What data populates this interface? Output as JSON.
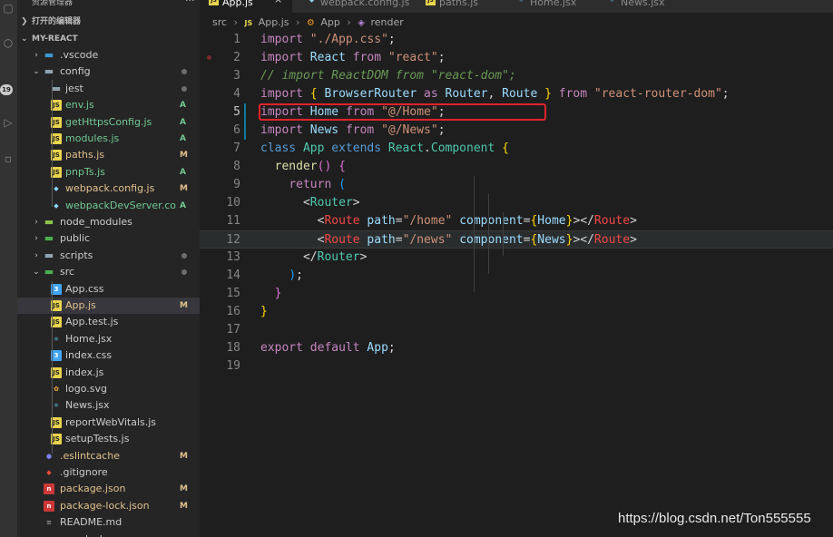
{
  "sidebar": {
    "title": "资源管理器",
    "open_editors": "打开的编辑器",
    "project": "MY-REACT",
    "items": [
      {
        "name": ".vscode",
        "kind": "folder",
        "icon": "vscode-folder-icon",
        "status": "",
        "dot": false
      },
      {
        "name": "config",
        "kind": "folder-open",
        "icon": "folder-icon",
        "status": "",
        "dot": true
      },
      {
        "name": "jest",
        "kind": "folder",
        "icon": "folder-icon",
        "status": "",
        "dot": true
      },
      {
        "name": "env.js",
        "kind": "file",
        "icon": "js-icon",
        "status": "A"
      },
      {
        "name": "getHttpsConfig.js",
        "kind": "file",
        "icon": "js-icon",
        "status": "A"
      },
      {
        "name": "modules.js",
        "kind": "file",
        "icon": "js-icon",
        "status": "A"
      },
      {
        "name": "paths.js",
        "kind": "file",
        "icon": "js-icon",
        "status": "M"
      },
      {
        "name": "pnpTs.js",
        "kind": "file",
        "icon": "js-icon",
        "status": "A"
      },
      {
        "name": "webpack.config.js",
        "kind": "file",
        "icon": "webpack-icon",
        "status": "M"
      },
      {
        "name": "webpackDevServer.co...",
        "kind": "file",
        "icon": "webpack-icon",
        "status": "A"
      },
      {
        "name": "node_modules",
        "kind": "folder",
        "icon": "node-folder-icon",
        "status": ""
      },
      {
        "name": "public",
        "kind": "folder",
        "icon": "public-folder-icon",
        "status": ""
      },
      {
        "name": "scripts",
        "kind": "folder",
        "icon": "folder-icon",
        "status": "",
        "dot": true
      },
      {
        "name": "src",
        "kind": "folder-open",
        "icon": "src-folder-icon",
        "status": "",
        "dot": true
      },
      {
        "name": "App.css",
        "kind": "file",
        "icon": "css-icon",
        "status": ""
      },
      {
        "name": "App.js",
        "kind": "file",
        "icon": "js-icon",
        "status": "M",
        "selected": true
      },
      {
        "name": "App.test.js",
        "kind": "file",
        "icon": "js-icon",
        "status": ""
      },
      {
        "name": "Home.jsx",
        "kind": "file",
        "icon": "react-icon",
        "status": ""
      },
      {
        "name": "index.css",
        "kind": "file",
        "icon": "css-icon",
        "status": ""
      },
      {
        "name": "index.js",
        "kind": "file",
        "icon": "js-icon",
        "status": ""
      },
      {
        "name": "logo.svg",
        "kind": "file",
        "icon": "svg-icon",
        "status": ""
      },
      {
        "name": "News.jsx",
        "kind": "file",
        "icon": "react-icon",
        "status": ""
      },
      {
        "name": "reportWebVitals.js",
        "kind": "file",
        "icon": "js-icon",
        "status": ""
      },
      {
        "name": "setupTests.js",
        "kind": "file",
        "icon": "js-icon",
        "status": ""
      },
      {
        "name": ".eslintcache",
        "kind": "file",
        "icon": "eslint-icon",
        "status": "M"
      },
      {
        "name": ".gitignore",
        "kind": "file",
        "icon": "git-icon",
        "status": ""
      },
      {
        "name": "package.json",
        "kind": "file",
        "icon": "npm-icon",
        "status": "M"
      },
      {
        "name": "package-lock.json",
        "kind": "file",
        "icon": "npm-icon",
        "status": "M"
      },
      {
        "name": "README.md",
        "kind": "file",
        "icon": "readme-icon",
        "status": ""
      },
      {
        "name": "yarn.lock",
        "kind": "file",
        "icon": "yarn-icon",
        "status": ""
      }
    ]
  },
  "activity_badge": "19",
  "tabs": [
    {
      "label": "App.js",
      "icon": "js-icon",
      "active": true,
      "close": "×"
    },
    {
      "label": "webpack.config.js",
      "icon": "webpack-icon",
      "active": false
    },
    {
      "label": "paths.js",
      "icon": "js-icon",
      "active": false
    },
    {
      "label": "Home.jsx",
      "icon": "react-icon",
      "active": false
    },
    {
      "label": "News.jsx",
      "icon": "react-icon",
      "active": false
    }
  ],
  "breadcrumb": [
    "src",
    "App.js",
    "App",
    "render"
  ],
  "code_lines": [
    [
      [
        "kw",
        "import"
      ],
      [
        "pun",
        " "
      ],
      [
        "str",
        "\"./App.css\""
      ],
      [
        "pun",
        ";"
      ]
    ],
    [
      [
        "kw",
        "import"
      ],
      [
        "pun",
        " "
      ],
      [
        "id",
        "React"
      ],
      [
        "pun",
        " "
      ],
      [
        "kw",
        "from"
      ],
      [
        "pun",
        " "
      ],
      [
        "str",
        "\"react\""
      ],
      [
        "pun",
        ";"
      ]
    ],
    [
      [
        "cmt",
        "// import ReactDOM from \"react-dom\";"
      ]
    ],
    [
      [
        "kw",
        "import"
      ],
      [
        "pun",
        " "
      ],
      [
        "br",
        "{"
      ],
      [
        "pun",
        " "
      ],
      [
        "id",
        "BrowserRouter"
      ],
      [
        "pun",
        " "
      ],
      [
        "kw",
        "as"
      ],
      [
        "pun",
        " "
      ],
      [
        "id",
        "Router"
      ],
      [
        "pun",
        ", "
      ],
      [
        "id",
        "Route"
      ],
      [
        "pun",
        " "
      ],
      [
        "br",
        "}"
      ],
      [
        "pun",
        " "
      ],
      [
        "kw",
        "from"
      ],
      [
        "pun",
        " "
      ],
      [
        "str",
        "\"react-router-dom\""
      ],
      [
        "pun",
        ";"
      ]
    ],
    [
      [
        "kw",
        "import"
      ],
      [
        "pun",
        " "
      ],
      [
        "id",
        "Home"
      ],
      [
        "pun",
        " "
      ],
      [
        "kw",
        "from"
      ],
      [
        "pun",
        " "
      ],
      [
        "str",
        "\"@/Home\""
      ],
      [
        "pun",
        ";"
      ]
    ],
    [
      [
        "kw",
        "import"
      ],
      [
        "pun",
        " "
      ],
      [
        "id",
        "News"
      ],
      [
        "pun",
        " "
      ],
      [
        "kw",
        "from"
      ],
      [
        "pun",
        " "
      ],
      [
        "str",
        "\"@/News\""
      ],
      [
        "pun",
        ";"
      ]
    ],
    [
      [
        "kw2",
        "class"
      ],
      [
        "pun",
        " "
      ],
      [
        "cls",
        "App"
      ],
      [
        "pun",
        " "
      ],
      [
        "kw2",
        "extends"
      ],
      [
        "pun",
        " "
      ],
      [
        "cls",
        "React"
      ],
      [
        "pun",
        "."
      ],
      [
        "cls",
        "Component"
      ],
      [
        "pun",
        " "
      ],
      [
        "br",
        "{"
      ]
    ],
    [
      [
        "pun",
        "  "
      ],
      [
        "fn",
        "render"
      ],
      [
        "br2",
        "()"
      ],
      [
        "pun",
        " "
      ],
      [
        "br2",
        "{"
      ]
    ],
    [
      [
        "pun",
        "    "
      ],
      [
        "kw",
        "return"
      ],
      [
        "pun",
        " "
      ],
      [
        "br3",
        "("
      ]
    ],
    [
      [
        "pun",
        "      "
      ],
      [
        "pun",
        "<"
      ],
      [
        "cls",
        "Router"
      ],
      [
        "pun",
        ">"
      ]
    ],
    [
      [
        "pun",
        "        "
      ],
      [
        "pun",
        "<"
      ],
      [
        "tag",
        "Route"
      ],
      [
        "pun",
        " "
      ],
      [
        "attr",
        "path"
      ],
      [
        "pun",
        "="
      ],
      [
        "str",
        "\"/home\""
      ],
      [
        "pun",
        " "
      ],
      [
        "attr",
        "component"
      ],
      [
        "pun",
        "="
      ],
      [
        "br",
        "{"
      ],
      [
        "id",
        "Home"
      ],
      [
        "br",
        "}"
      ],
      [
        "pun",
        "></"
      ],
      [
        "tag",
        "Route"
      ],
      [
        "pun",
        ">"
      ]
    ],
    [
      [
        "pun",
        "        "
      ],
      [
        "pun",
        "<"
      ],
      [
        "tag",
        "Route"
      ],
      [
        "pun",
        " "
      ],
      [
        "attr",
        "path"
      ],
      [
        "pun",
        "="
      ],
      [
        "str",
        "\"/news\""
      ],
      [
        "pun",
        " "
      ],
      [
        "attr",
        "component"
      ],
      [
        "pun",
        "="
      ],
      [
        "br",
        "{"
      ],
      [
        "id",
        "News"
      ],
      [
        "br",
        "}"
      ],
      [
        "pun",
        "></"
      ],
      [
        "tag",
        "Route"
      ],
      [
        "pun",
        ">"
      ]
    ],
    [
      [
        "pun",
        "      "
      ],
      [
        "pun",
        "</"
      ],
      [
        "cls",
        "Router"
      ],
      [
        "pun",
        ">"
      ]
    ],
    [
      [
        "pun",
        "    "
      ],
      [
        "br3",
        ")"
      ],
      [
        "pun",
        ";"
      ]
    ],
    [
      [
        "pun",
        "  "
      ],
      [
        "br2",
        "}"
      ]
    ],
    [
      [
        "br",
        "}"
      ]
    ],
    [],
    [
      [
        "kw",
        "export"
      ],
      [
        "pun",
        " "
      ],
      [
        "kw",
        "default"
      ],
      [
        "pun",
        " "
      ],
      [
        "id",
        "App"
      ],
      [
        "pun",
        ";"
      ]
    ],
    []
  ],
  "watermark": "https://blog.csdn.net/Ton555555"
}
